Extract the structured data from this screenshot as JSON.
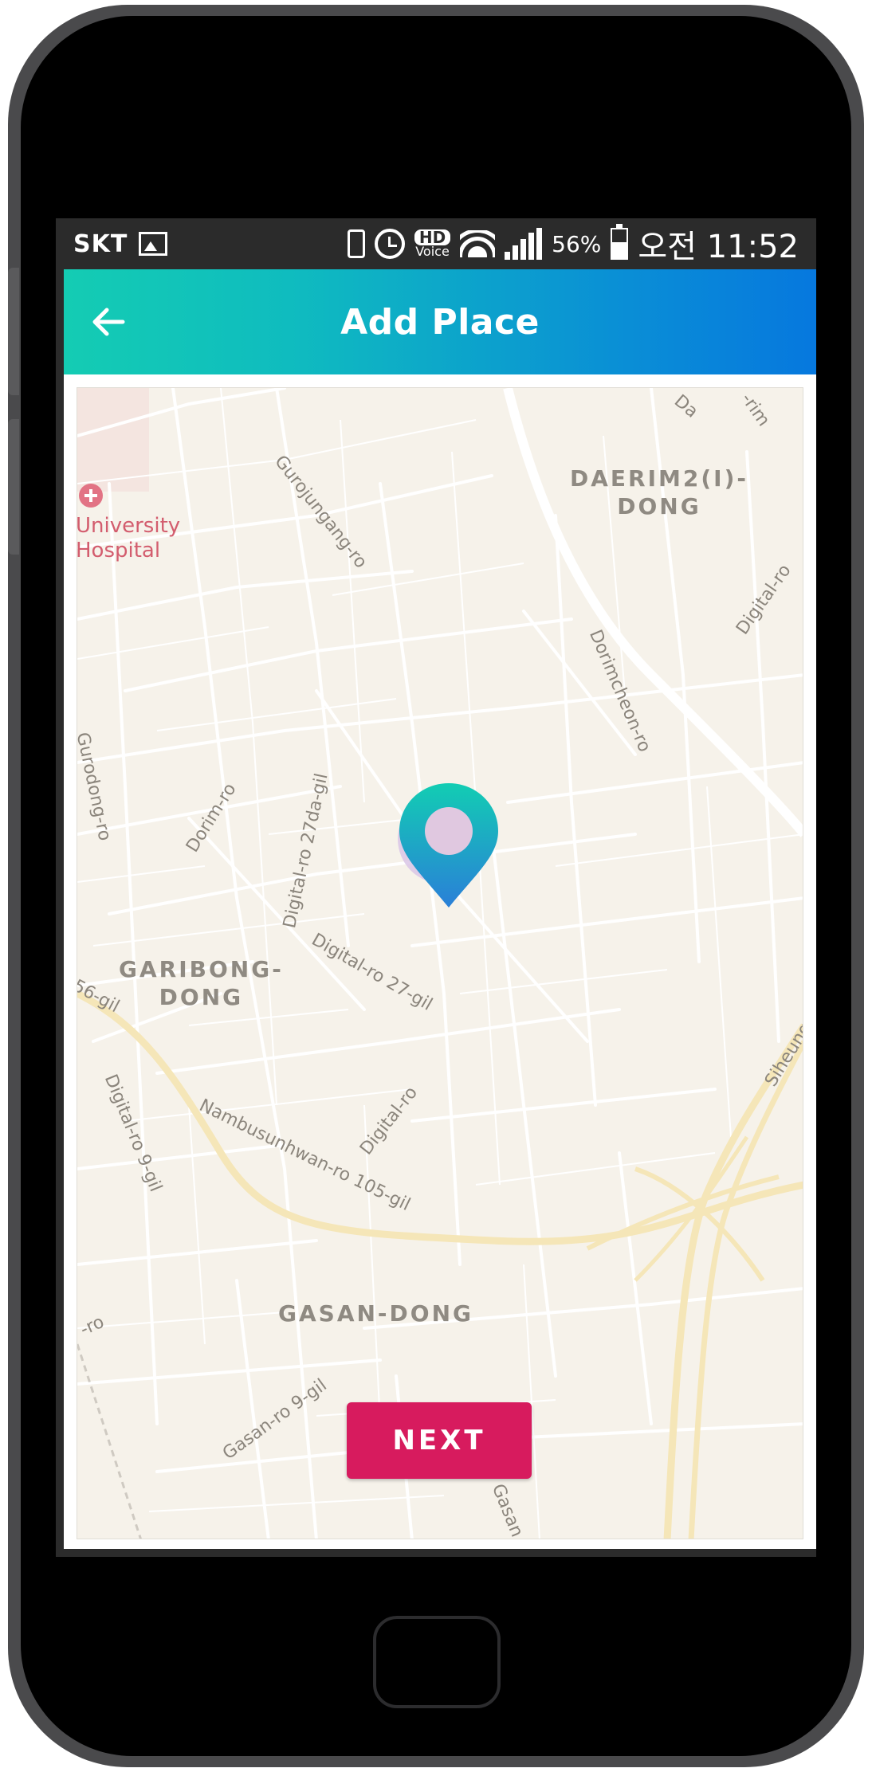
{
  "status_bar": {
    "carrier": "SKT",
    "hd_label": "HD",
    "voice_label": "Voice",
    "battery_percent": "56%",
    "clock": "오전 11:52",
    "icons": [
      "image-icon",
      "vibrate-icon",
      "alarm-icon",
      "hd-voice-icon",
      "wifi-icon",
      "signal-icon",
      "battery-icon"
    ]
  },
  "app_bar": {
    "title": "Add Place",
    "back_icon": "arrow-left-icon",
    "gradient_start": "#14ccb3",
    "gradient_end": "#0678de"
  },
  "map": {
    "districts": [
      {
        "line1": "DAERIM2(I)-",
        "line2": "DONG"
      },
      {
        "line1": "GARIBONG-",
        "line2": "DONG"
      },
      {
        "line1": "GASAN-DONG",
        "line2": ""
      }
    ],
    "poi": {
      "line1": "University",
      "line2": "Hospital",
      "icon": "hospital-icon"
    },
    "roads": [
      "Gurojungang-ro",
      "Dorimcheon-ro",
      "Digital-ro",
      "Gurodong-ro",
      "Dorim-ro",
      "Digital-ro 27da-gil",
      "Digital-ro 27-gil",
      "56-gil",
      "Digital-ro 9-gil",
      "Nambusunhwan-ro 105-gil",
      "Digital-ro",
      "Siheung",
      "Gasan-ro 9-gil",
      "-ro",
      "Gasan",
      "Da",
      "-rim"
    ],
    "marker_icon": "location-pin-icon",
    "marker_colors": {
      "top": "#12cdb3",
      "bottom": "#2a7fd8",
      "center": "#e0c8e0"
    }
  },
  "actions": {
    "next_label": "NEXT",
    "next_color": "#d71b5e"
  }
}
